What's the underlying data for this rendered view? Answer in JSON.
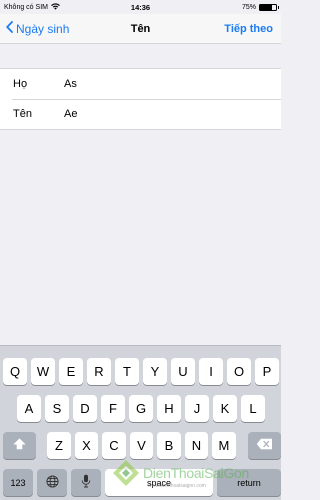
{
  "status_bar": {
    "carrier": "Không có SIM",
    "time": "14:36",
    "battery_text": "75%",
    "battery_level": 0.75
  },
  "nav": {
    "back_label": "Ngày sinh",
    "title": "Tên",
    "next_label": "Tiếp theo",
    "accent": "#1a7cf5"
  },
  "form": {
    "rows": [
      {
        "label": "Họ",
        "value": "As"
      },
      {
        "label": "Tên",
        "value": "Ae"
      }
    ]
  },
  "keyboard": {
    "row1": [
      "Q",
      "W",
      "E",
      "R",
      "T",
      "Y",
      "U",
      "I",
      "O",
      "P"
    ],
    "row2": [
      "A",
      "S",
      "D",
      "F",
      "G",
      "H",
      "J",
      "K",
      "L"
    ],
    "row3": [
      "Z",
      "X",
      "C",
      "V",
      "B",
      "N",
      "M"
    ],
    "numbers_label": "123",
    "space_label": "space",
    "return_label": "return",
    "icons": [
      "shift-icon",
      "backspace-icon",
      "globe-icon",
      "microphone-icon"
    ]
  },
  "watermark": {
    "brand": "DienThoaiSaiGon",
    "sub": "www.dienthoaisaigon.com"
  }
}
